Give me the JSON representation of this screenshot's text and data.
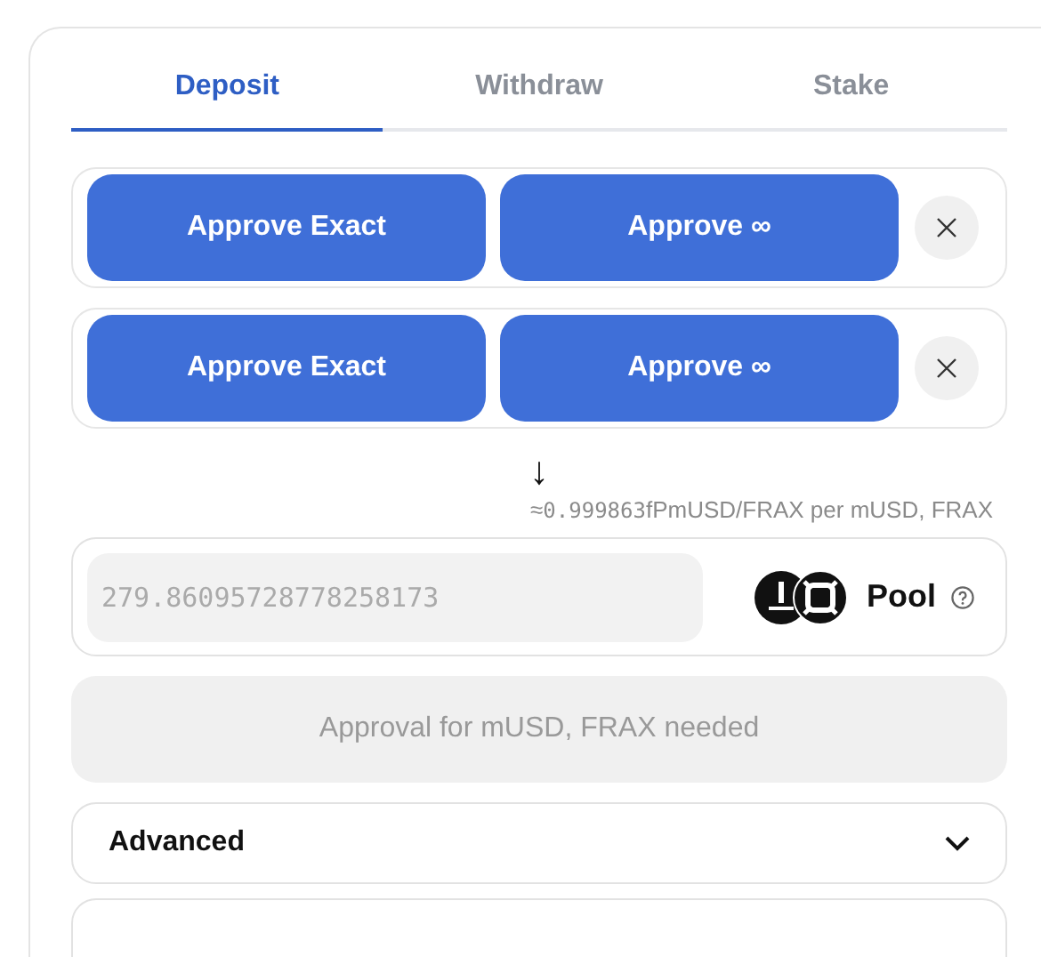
{
  "tabs": [
    {
      "label": "Deposit",
      "selected": true
    },
    {
      "label": "Withdraw",
      "selected": false
    },
    {
      "label": "Stake",
      "selected": false
    }
  ],
  "approvals": [
    {
      "exact": "Approve Exact",
      "infinite": "Approve ∞"
    },
    {
      "exact": "Approve Exact",
      "infinite": "Approve ∞"
    }
  ],
  "arrow": "↓",
  "rate": {
    "approx": "≈",
    "value": "0.999863",
    "unit": "fPmUSD/FRAX per mUSD, FRAX"
  },
  "output": {
    "value": "279.86095728778258173",
    "token": "Pool"
  },
  "submit": {
    "label": "Approval for mUSD, FRAX needed",
    "disabled": true
  },
  "advanced": {
    "label": "Advanced",
    "expanded": false
  }
}
